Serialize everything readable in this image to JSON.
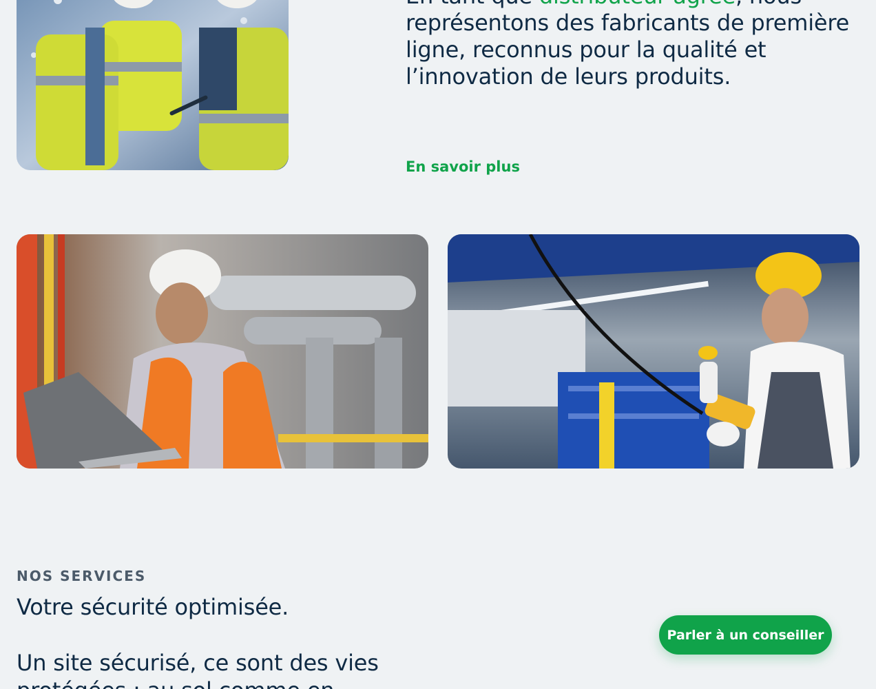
{
  "intro": {
    "text_before": "En tant que ",
    "text_accent": "distributeur agréé",
    "text_after": ", nous représentons des fabricants de première ligne, reconnus pour la qualité et l’innovation de leurs produits.",
    "link_label": "En savoir plus"
  },
  "services": {
    "eyebrow": "Nos services",
    "title": "Votre sécurité optimisée.",
    "lead": "Un site sécurisé, ce sont des vies protégées : au sol comme en",
    "cta_label": "Parler à un conseiller"
  },
  "colors": {
    "accent": "#10a34a",
    "text": "#0f2a44",
    "muted": "#4b5a69",
    "background": "#eff2f4"
  },
  "images": {
    "top": "workers-hi-vis-tablet-photo",
    "left": "engineer-laptop-plant-photo",
    "right": "worker-crane-remote-warehouse-photo"
  }
}
